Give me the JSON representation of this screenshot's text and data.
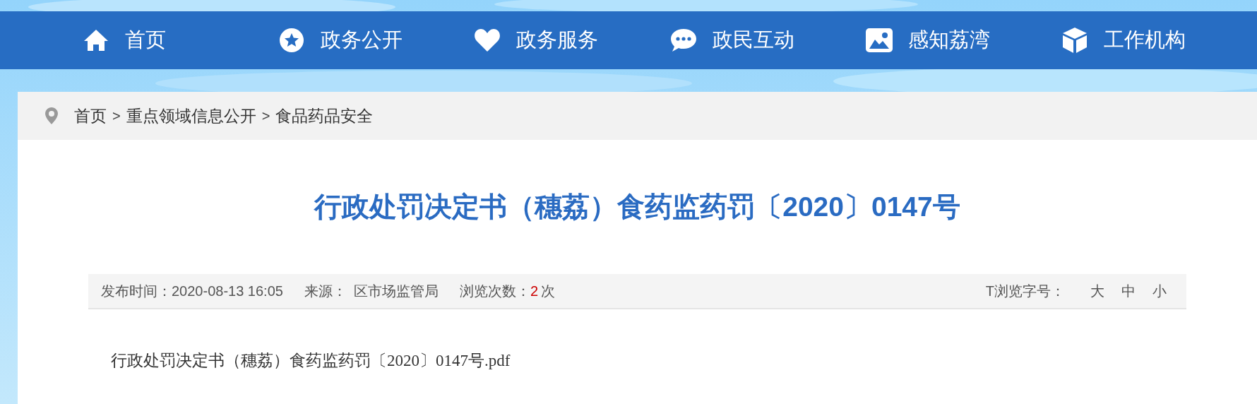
{
  "nav": {
    "items": [
      {
        "label": "首页"
      },
      {
        "label": "政务公开"
      },
      {
        "label": "政务服务"
      },
      {
        "label": "政民互动"
      },
      {
        "label": "感知荔湾"
      },
      {
        "label": "工作机构"
      }
    ]
  },
  "breadcrumb": {
    "items": [
      {
        "kind": "link",
        "text": "首页"
      },
      {
        "kind": "separator",
        "text": ">"
      },
      {
        "kind": "link",
        "text": "重点领域信息公开"
      },
      {
        "kind": "separator",
        "text": ">"
      },
      {
        "kind": "link",
        "text": "食品药品安全"
      }
    ]
  },
  "article": {
    "title": "行政处罚决定书（穗荔）食药监药罚〔2020〕0147号",
    "meta": {
      "publish_label": "发布时间：",
      "publish_time": "2020-08-13 16:05",
      "source_label": "来源：",
      "source": "区市场监管局",
      "views_label": "浏览次数：",
      "views": "2",
      "views_unit": "次"
    },
    "font_size": {
      "label": "T浏览字号：",
      "options": [
        "大",
        "中",
        "小"
      ]
    },
    "attachment": "行政处罚决定书（穗荔）食药监药罚〔2020〕0147号.pdf"
  }
}
